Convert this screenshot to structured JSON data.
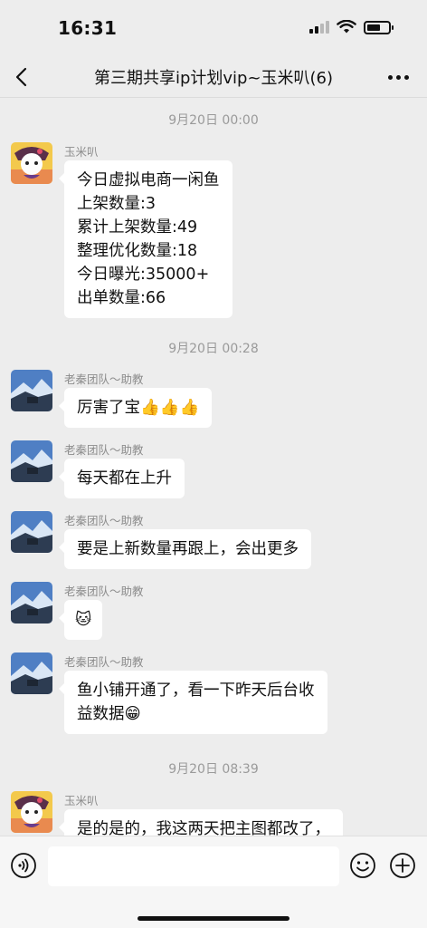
{
  "status_bar": {
    "time": "16:31"
  },
  "nav": {
    "title": "第三期共享ip计划vip~玉米叭(6)"
  },
  "timestamps": [
    "9月20日 00:00",
    "9月20日 00:28",
    "9月20日 08:39"
  ],
  "messages": [
    {
      "sender": "玉米叭",
      "lines": [
        "今日虚拟电商一闲鱼",
        "上架数量:3",
        "累计上架数量:49",
        "整理优化数量:18",
        "今日曝光:35000+",
        "出单数量:66"
      ]
    },
    {
      "sender": "老秦团队～助教",
      "lines": [
        "厉害了宝👍👍👍"
      ]
    },
    {
      "sender": "老秦团队～助教",
      "lines": [
        "每天都在上升"
      ]
    },
    {
      "sender": "老秦团队～助教",
      "lines": [
        "要是上新数量再跟上，会出更多"
      ]
    },
    {
      "sender": "老秦团队～助教",
      "lines": [
        "🐱"
      ]
    },
    {
      "sender": "老秦团队～助教",
      "lines": [
        "鱼小铺开通了，看一下昨天后台收",
        "益数据😁"
      ]
    },
    {
      "sender": "玉米叭",
      "lines": [
        "是的是的，我这两天把主图都改了，"
      ]
    }
  ],
  "icons": {
    "back": "chevron-left-icon",
    "more": "more-dots-icon",
    "voice": "voice-icon",
    "emoji": "emoji-icon",
    "add": "add-icon"
  }
}
